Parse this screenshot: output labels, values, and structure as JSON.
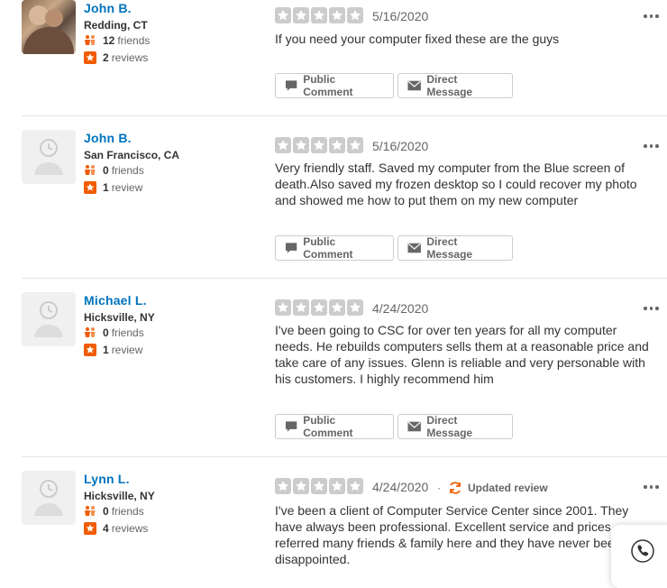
{
  "colors": {
    "name": "#0073bb",
    "star": "#cccccc",
    "badge": "#f15c00"
  },
  "buttons": {
    "public_comment": "Public Comment",
    "direct_message": "Direct Message"
  },
  "updated_label": "Updated review",
  "reviews": [
    {
      "name": "John B.",
      "location": "Redding, CT",
      "friends_count": "12",
      "friends_label": "friends",
      "reviews_count": "2",
      "reviews_label": "reviews",
      "rating": 5,
      "date": "5/16/2020",
      "text": "If you need your computer fixed these are the guys",
      "avatar": "photo"
    },
    {
      "name": "John B.",
      "location": "San Francisco, CA",
      "friends_count": "0",
      "friends_label": "friends",
      "reviews_count": "1",
      "reviews_label": "review",
      "rating": 5,
      "date": "5/16/2020",
      "text": "Very friendly staff. Saved my computer from the Blue screen of death.Also saved my frozen desktop so I could recover my photo and showed me how to put them on my new computer",
      "avatar": "default"
    },
    {
      "name": "Michael L.",
      "location": "Hicksville, NY",
      "friends_count": "0",
      "friends_label": "friends",
      "reviews_count": "1",
      "reviews_label": "review",
      "rating": 5,
      "date": "4/24/2020",
      "text": "I've been going to CSC for over ten years for all my computer needs. He rebuilds computers sells them at a reasonable price and take care of any issues. Glenn is reliable and very personable with his customers. I highly recommend him",
      "avatar": "default"
    },
    {
      "name": "Lynn L.",
      "location": "Hicksville, NY",
      "friends_count": "0",
      "friends_label": "friends",
      "reviews_count": "4",
      "reviews_label": "reviews",
      "rating": 5,
      "date": "4/24/2020",
      "updated": true,
      "text": "I've been a client of Computer Service Center since 2001. They have always been professional. Excellent service and prices referred many friends & family here and they have never been disappointed.",
      "avatar": "default"
    }
  ]
}
